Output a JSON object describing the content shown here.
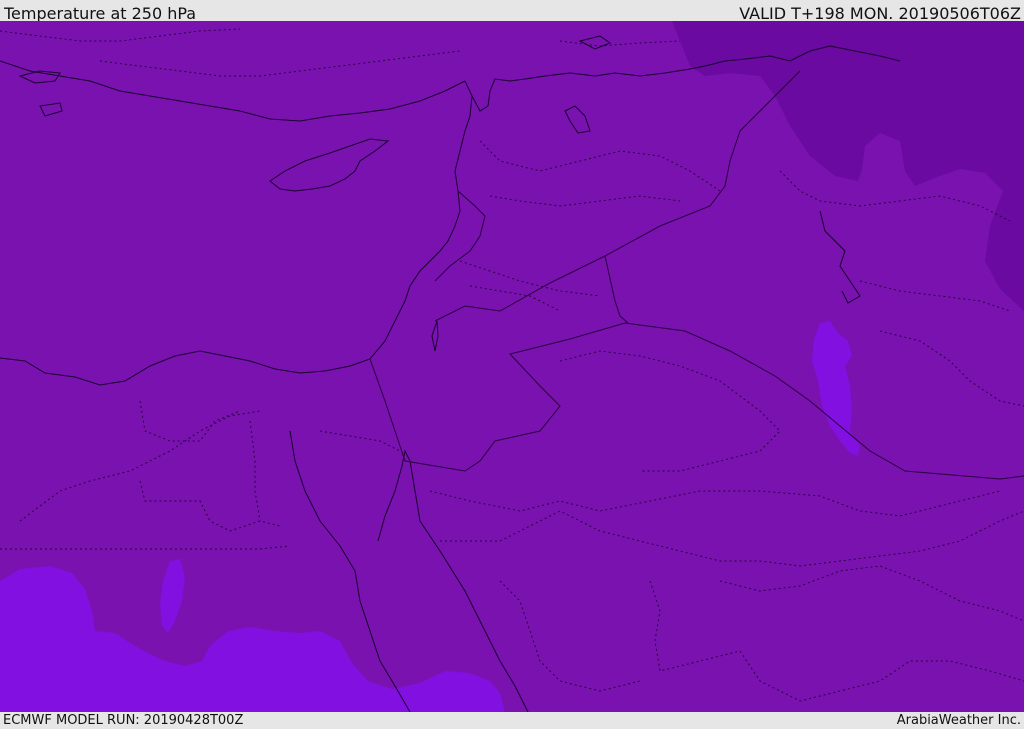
{
  "header": {
    "title": "Temperature at 250 hPa",
    "valid": "VALID T+198 MON. 20190506T06Z"
  },
  "footer": {
    "model_run": "ECMWF MODEL RUN: 20190428T00Z",
    "credit": "ArabiaWeather Inc."
  },
  "map": {
    "colors": {
      "base_field": "#7a12b0",
      "cold_field": "#6a0aa0",
      "warm_field": "#8210e0",
      "coastline": "#1a0030",
      "border": "#2a0040"
    }
  }
}
